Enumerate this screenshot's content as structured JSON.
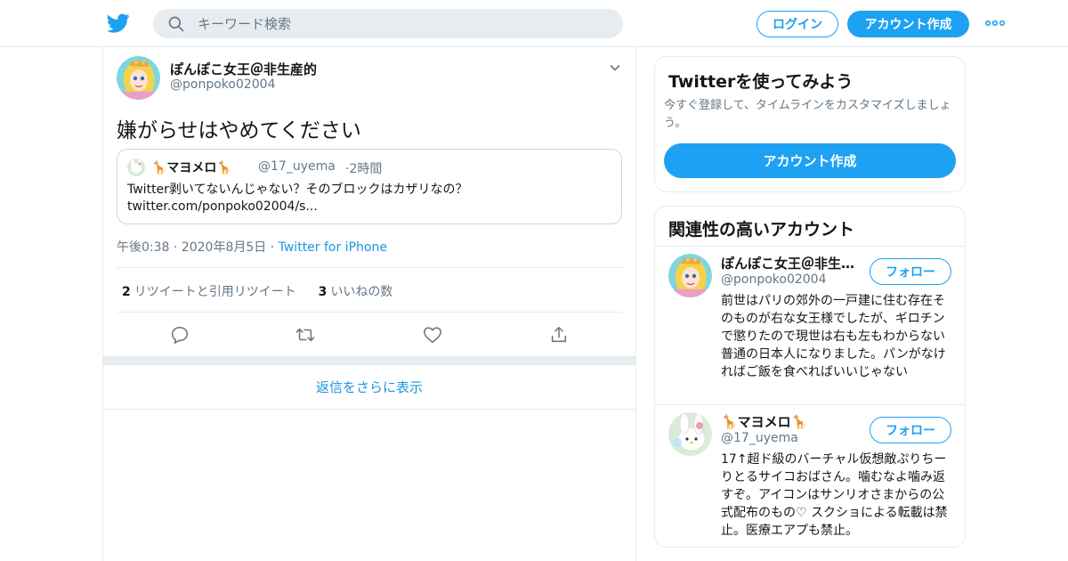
{
  "colors": {
    "brand": "#1da1f2",
    "link": "#1b95e0",
    "muted": "#657786",
    "border": "#e6ecf0"
  },
  "header": {
    "logo_icon": "twitter-bird-icon",
    "search_placeholder": "キーワード検索",
    "login_label": "ログイン",
    "signup_label": "アカウント作成",
    "more_icon": "more-dots-icon"
  },
  "tweet": {
    "author_name": "ぽんぽこ女王＠非生産的",
    "author_handle": "@ponpoko02004",
    "text": "嫌がらせはやめてください",
    "quote": {
      "name": "🦒マヨメロ🦒",
      "handle": "@17_uyema",
      "dot": "·",
      "time": "2時間",
      "text_line1": "Twitter剥いてないんじゃない？そのブロックはカザリなの？",
      "text_line2": "twitter.com/ponpoko02004/s..."
    },
    "time": "午後0:38",
    "dot": "·",
    "date": "2020年8月5日",
    "source": "Twitter for iPhone",
    "retweet_count": "2",
    "retweet_label": "リツイートと引用リツイート",
    "like_count": "3",
    "like_label": "いいねの数",
    "actions": [
      "reply-icon",
      "retweet-icon",
      "like-icon",
      "share-icon"
    ]
  },
  "more_replies_label": "返信をさらに表示",
  "signup_card": {
    "title": "Twitterを使ってみよう",
    "description": "今すぐ登録して、タイムラインをカスタマイズしましょう。",
    "button_label": "アカウント作成"
  },
  "related": {
    "title": "関連性の高いアカウント",
    "accounts": [
      {
        "name": "ぽんぽこ女王＠非生産的",
        "handle": "@ponpoko02004",
        "follow_label": "フォロー",
        "bio": "前世はパリの郊外の一戸建に住む存在そのものが右な女王様でしたが、ギロチンで懲りたので現世は右も左もわからない普通の日本人になりました。パンがなければご飯を食べればいいじゃない"
      },
      {
        "name": "🦒マヨメロ🦒",
        "handle": "@17_uyema",
        "follow_label": "フォロー",
        "bio": "17↑超ド級のバーチャル仮想敵ぷりちーりとるサイコおばさん。噛むなよ噛み返すぞ。アイコンはサンリオさまからの公式配布のもの♡ スクショによる転載は禁止。医療エアプも禁止。"
      }
    ]
  }
}
